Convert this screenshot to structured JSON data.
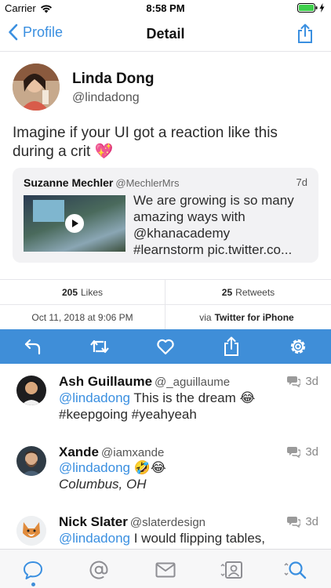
{
  "status_bar": {
    "carrier": "Carrier",
    "time": "8:58 PM"
  },
  "nav": {
    "back_label": "Profile",
    "title": "Detail"
  },
  "tweet": {
    "author_name": "Linda Dong",
    "author_handle": "@lindadong",
    "text": "Imagine if your UI got a reaction like this during a crit 💖",
    "quote": {
      "author_name": "Suzanne Mechler",
      "author_handle": "@MechlerMrs",
      "date": "7d",
      "lines": [
        "We are growing is so many",
        "amazing ways with",
        "@khanacademy",
        "#learnstorm pic.twitter.co..."
      ]
    }
  },
  "stats": {
    "likes_count": "205",
    "likes_label": "Likes",
    "retweets_count": "25",
    "retweets_label": "Retweets",
    "timestamp": "Oct 11, 2018 at 9:06 PM",
    "via_prefix": "via",
    "client": "Twitter for iPhone"
  },
  "action_icons": [
    "reply-icon",
    "retweet-icon",
    "heart-icon",
    "share-icon",
    "gear-icon"
  ],
  "replies": [
    {
      "name": "Ash Guillaume",
      "handle": "@_aguillaume",
      "date": "3d",
      "mention": "@lindadong",
      "text": " This is the dream 😂",
      "hashtags": "#keepgoing #yeahyeah"
    },
    {
      "name": "Xande",
      "handle": "@iamxande",
      "date": "3d",
      "mention": "@lindadong",
      "text": " 🤣😂",
      "location": "Columbus, OH"
    },
    {
      "name": "Nick Slater",
      "handle": "@slaterdesign",
      "date": "3d",
      "mention": "@lindadong",
      "text": " I would flipping tables,"
    }
  ],
  "tab_icons": [
    "chat-icon",
    "mention-icon",
    "mail-icon",
    "profile-icon",
    "search-icon"
  ],
  "colors": {
    "accent": "#3f8ed8",
    "link": "#3a8fe0"
  }
}
